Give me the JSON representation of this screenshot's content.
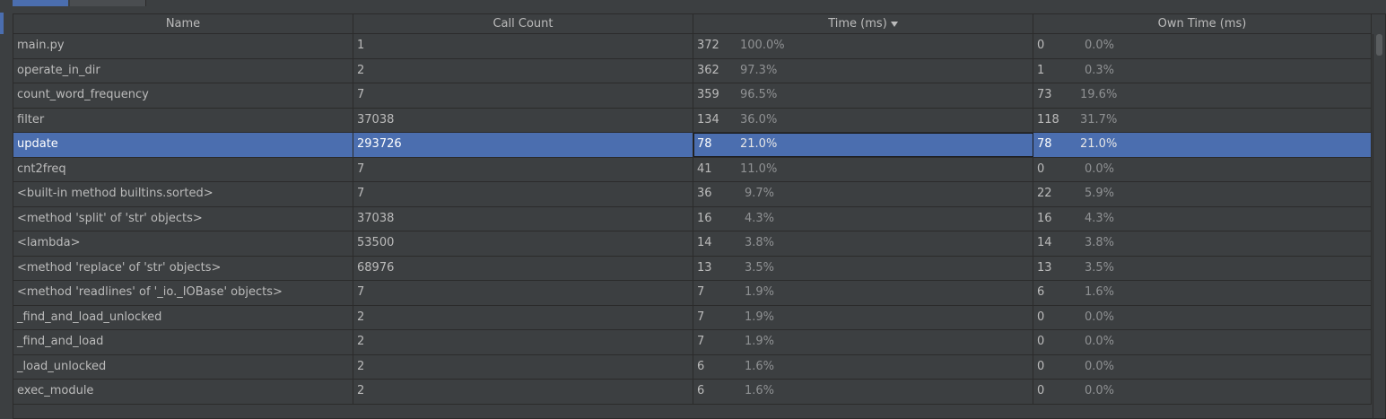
{
  "columns": {
    "name": "Name",
    "count": "Call Count",
    "time": "Time (ms)",
    "own": "Own Time (ms)"
  },
  "sort": {
    "column": "time",
    "direction": "descending",
    "icon": "sort-desc-arrow-icon"
  },
  "selected_row": 4,
  "rows": [
    {
      "name": "main.py",
      "count": "1",
      "time": "372",
      "time_pct": "100.0%",
      "own": "0",
      "own_pct": "0.0%"
    },
    {
      "name": "operate_in_dir",
      "count": "2",
      "time": "362",
      "time_pct": "97.3%",
      "own": "1",
      "own_pct": "0.3%"
    },
    {
      "name": "count_word_frequency",
      "count": "7",
      "time": "359",
      "time_pct": "96.5%",
      "own": "73",
      "own_pct": "19.6%"
    },
    {
      "name": "filter",
      "count": "37038",
      "time": "134",
      "time_pct": "36.0%",
      "own": "118",
      "own_pct": "31.7%"
    },
    {
      "name": "update",
      "count": "293726",
      "time": "78",
      "time_pct": "21.0%",
      "own": "78",
      "own_pct": "21.0%"
    },
    {
      "name": "cnt2freq",
      "count": "7",
      "time": "41",
      "time_pct": "11.0%",
      "own": "0",
      "own_pct": "0.0%"
    },
    {
      "name": "<built-in method builtins.sorted>",
      "count": "7",
      "time": "36",
      "time_pct": "9.7%",
      "own": "22",
      "own_pct": "5.9%"
    },
    {
      "name": "<method 'split' of 'str' objects>",
      "count": "37038",
      "time": "16",
      "time_pct": "4.3%",
      "own": "16",
      "own_pct": "4.3%"
    },
    {
      "name": "<lambda>",
      "count": "53500",
      "time": "14",
      "time_pct": "3.8%",
      "own": "14",
      "own_pct": "3.8%"
    },
    {
      "name": "<method 'replace' of 'str' objects>",
      "count": "68976",
      "time": "13",
      "time_pct": "3.5%",
      "own": "13",
      "own_pct": "3.5%"
    },
    {
      "name": "<method 'readlines' of '_io._IOBase' objects>",
      "count": "7",
      "time": "7",
      "time_pct": "1.9%",
      "own": "6",
      "own_pct": "1.6%"
    },
    {
      "name": "_find_and_load_unlocked",
      "count": "2",
      "time": "7",
      "time_pct": "1.9%",
      "own": "0",
      "own_pct": "0.0%"
    },
    {
      "name": "_find_and_load",
      "count": "2",
      "time": "7",
      "time_pct": "1.9%",
      "own": "0",
      "own_pct": "0.0%"
    },
    {
      "name": "_load_unlocked",
      "count": "2",
      "time": "6",
      "time_pct": "1.6%",
      "own": "0",
      "own_pct": "0.0%"
    },
    {
      "name": "exec_module",
      "count": "2",
      "time": "6",
      "time_pct": "1.6%",
      "own": "0",
      "own_pct": "0.0%"
    }
  ],
  "colors": {
    "background": "#3c3f41",
    "selection": "#4b6eaf",
    "grid": "#2b2b2b",
    "text": "#bbbbbb"
  }
}
